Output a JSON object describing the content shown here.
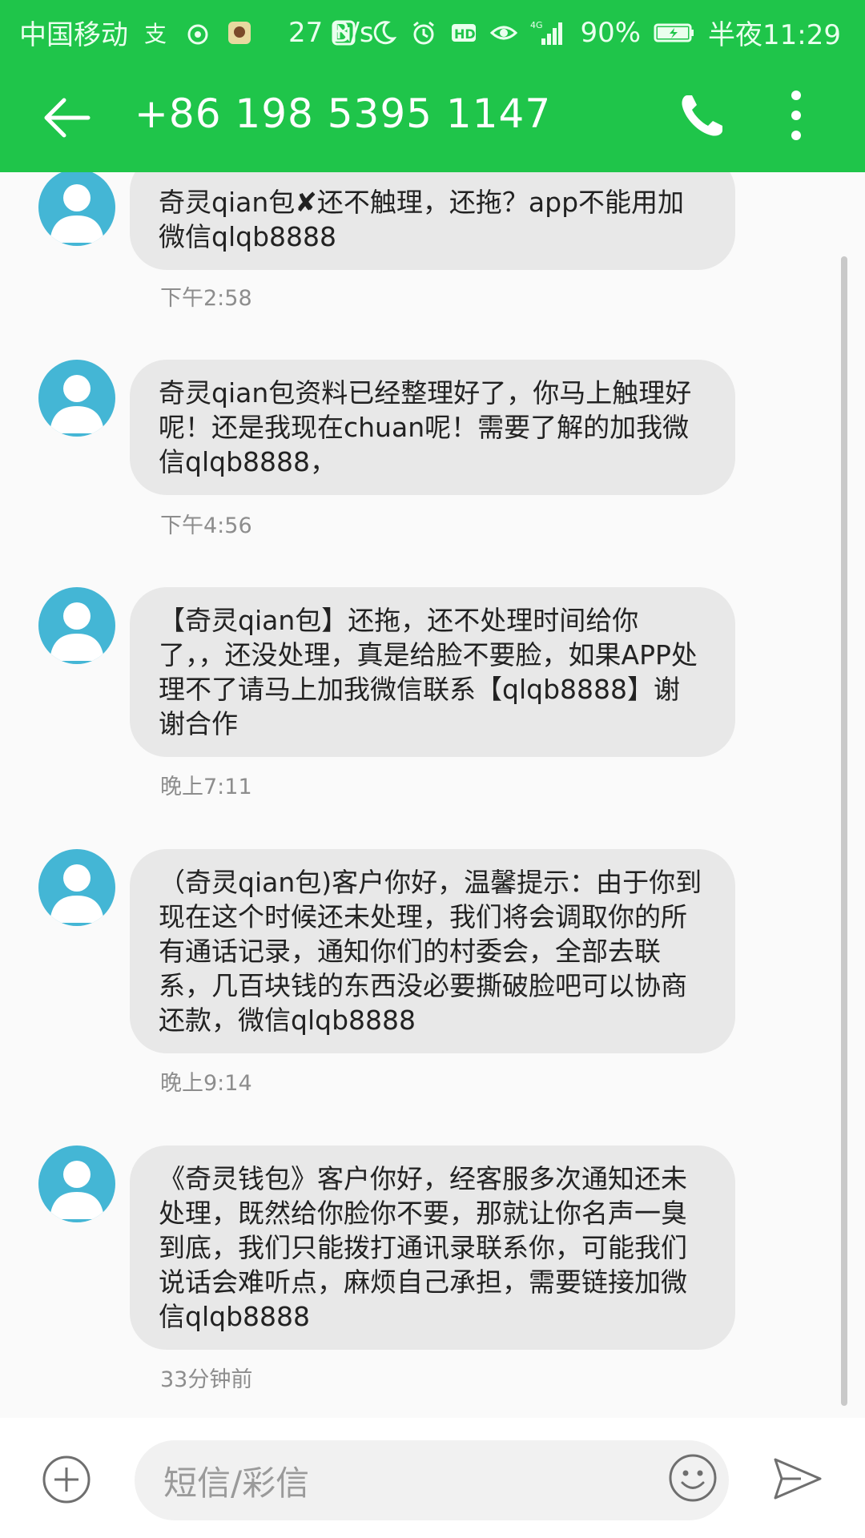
{
  "status_bar": {
    "carrier": "中国移动",
    "net_speed": "27 B/s",
    "battery": "90%",
    "time": "半夜11:29"
  },
  "header": {
    "title": "+86 198 5395 1147"
  },
  "messages": [
    {
      "text": "奇灵qian包✘还不触理，还拖？app不能用加微信qlqb8888",
      "time": "下午2:58"
    },
    {
      "text": "奇灵qian包资料已经整理好了，你马上触理好呢！还是我现在chuan呢！需要了解的加我微信qlqb8888，",
      "time": "下午4:56"
    },
    {
      "text": "【奇灵qian包】还拖，还不处理时间给你了，，还没处理，真是给脸不要脸，如果APP处理不了请马上加我微信联系【qlqb8888】谢谢合作",
      "time": "晚上7:11"
    },
    {
      "text": "（奇灵qian包)客户你好，温馨提示：由于你到现在这个时候还未处理，我们将会调取你的所有通话记录，通知你们的村委会，全部去联系，几百块钱的东西没必要撕破脸吧可以协商还款，微信qlqb8888",
      "time": "晚上9:14"
    },
    {
      "text": "《奇灵钱包》客户你好，经客服多次通知还未处理，既然给你脸你不要，那就让你名声一臭到底，我们只能拨打通讯录联系你，可能我们说话会难听点，麻烦自己承担，需要链接加微信qlqb8888",
      "time": "33分钟前"
    }
  ],
  "composer": {
    "placeholder": "短信/彩信"
  },
  "colors": {
    "header_green": "#1fc54a",
    "avatar_blue": "#44b6d5",
    "bubble_gray": "#e8e8e8"
  }
}
